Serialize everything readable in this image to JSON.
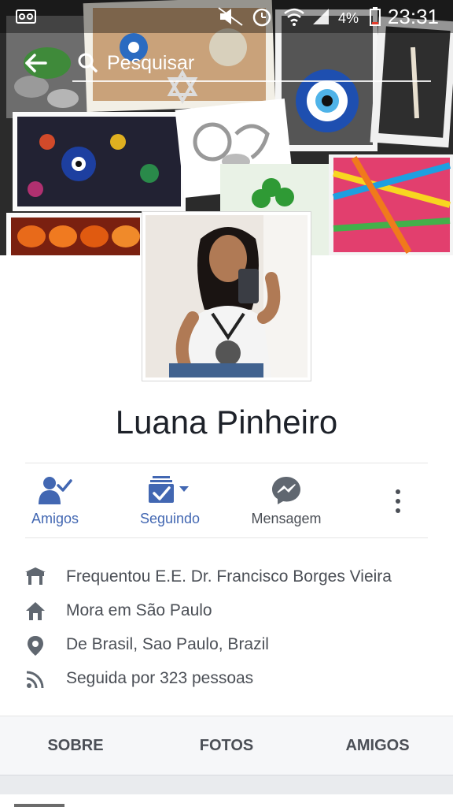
{
  "status_bar": {
    "battery_percent": "4%",
    "time": "23:31",
    "icons": [
      "voicemail-icon",
      "mute-icon",
      "alarm-icon",
      "wifi-icon",
      "signal-icon",
      "battery-icon"
    ]
  },
  "search": {
    "placeholder": "Pesquisar",
    "icons": [
      "back-arrow-icon",
      "search-icon"
    ]
  },
  "profile": {
    "name": "Luana Pinheiro"
  },
  "actions": [
    {
      "label": "Amigos",
      "icon": "friends-check-icon",
      "color": "#4267b2"
    },
    {
      "label": "Seguindo",
      "icon": "following-check-icon",
      "color": "#4267b2"
    },
    {
      "label": "Mensagem",
      "icon": "messenger-icon",
      "color": "#4b4f56"
    }
  ],
  "info": [
    {
      "text": "Frequentou E.E. Dr. Francisco Borges Vieira",
      "icon": "school-icon"
    },
    {
      "text": "Mora em São Paulo",
      "icon": "home-icon"
    },
    {
      "text": "De Brasil, Sao Paulo, Brazil",
      "icon": "location-pin-icon"
    },
    {
      "text": "Seguida por 323 pessoas",
      "icon": "rss-follow-icon"
    }
  ],
  "tabs": [
    {
      "label": "SOBRE"
    },
    {
      "label": "FOTOS"
    },
    {
      "label": "AMIGOS"
    }
  ],
  "colors": {
    "accent": "#4267b2",
    "text_dark": "#1d2129",
    "text_muted": "#4b4f56",
    "icon_gray": "#606770"
  }
}
